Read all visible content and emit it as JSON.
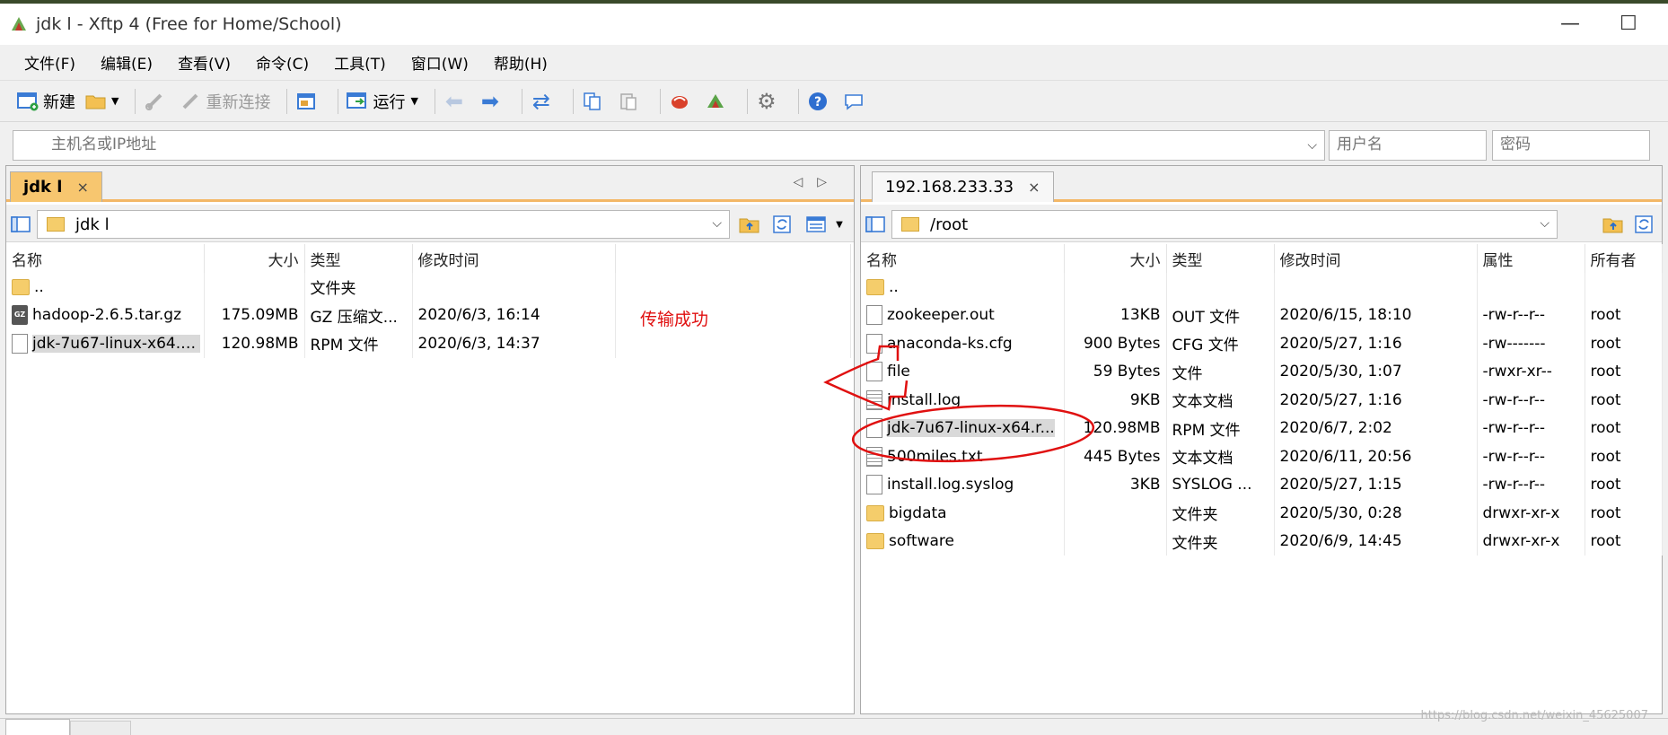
{
  "window": {
    "title": "jdk l - Xftp 4 (Free for Home/School)",
    "minimize": "—",
    "maximize": "☐"
  },
  "menu": [
    "文件(F)",
    "编辑(E)",
    "查看(V)",
    "命令(C)",
    "工具(T)",
    "窗口(W)",
    "帮助(H)"
  ],
  "toolbar": {
    "new_label": "新建",
    "reconnect_label": "重新连接",
    "run_label": "运行"
  },
  "address": {
    "host_placeholder": "主机名或IP地址",
    "user_placeholder": "用户名",
    "password_placeholder": "密码"
  },
  "left_pane": {
    "tab_label": "jdk l",
    "path": "jdk l",
    "columns": [
      "名称",
      "大小",
      "类型",
      "修改时间"
    ],
    "rows": [
      {
        "name": "..",
        "size": "",
        "type": "文件夹",
        "modified": "",
        "icon": "folder"
      },
      {
        "name": "hadoop-2.6.5.tar.gz",
        "size": "175.09MB",
        "type": "GZ 压缩文...",
        "modified": "2020/6/3, 16:14",
        "icon": "gz"
      },
      {
        "name": "jdk-7u67-linux-x64.r...",
        "size": "120.98MB",
        "type": "RPM 文件",
        "modified": "2020/6/3, 14:37",
        "icon": "doc"
      }
    ],
    "annotation": "传输成功"
  },
  "right_pane": {
    "tab_label": "192.168.233.33",
    "path": "/root",
    "columns": [
      "名称",
      "大小",
      "类型",
      "修改时间",
      "属性",
      "所有者"
    ],
    "rows": [
      {
        "name": "..",
        "size": "",
        "type": "",
        "modified": "",
        "attr": "",
        "owner": "",
        "icon": "folder"
      },
      {
        "name": "zookeeper.out",
        "size": "13KB",
        "type": "OUT 文件",
        "modified": "2020/6/15, 18:10",
        "attr": "-rw-r--r--",
        "owner": "root",
        "icon": "doc"
      },
      {
        "name": "anaconda-ks.cfg",
        "size": "900 Bytes",
        "type": "CFG 文件",
        "modified": "2020/5/27, 1:16",
        "attr": "-rw-------",
        "owner": "root",
        "icon": "doc"
      },
      {
        "name": "file",
        "size": "59 Bytes",
        "type": "文件",
        "modified": "2020/5/30, 1:07",
        "attr": "-rwxr-xr--",
        "owner": "root",
        "icon": "doc"
      },
      {
        "name": "install.log",
        "size": "9KB",
        "type": "文本文档",
        "modified": "2020/5/27, 1:16",
        "attr": "-rw-r--r--",
        "owner": "root",
        "icon": "txt"
      },
      {
        "name": "jdk-7u67-linux-x64.r...",
        "size": "120.98MB",
        "type": "RPM 文件",
        "modified": "2020/6/7, 2:02",
        "attr": "-rw-r--r--",
        "owner": "root",
        "icon": "doc"
      },
      {
        "name": "500miles.txt",
        "size": "445 Bytes",
        "type": "文本文档",
        "modified": "2020/6/11, 20:56",
        "attr": "-rw-r--r--",
        "owner": "root",
        "icon": "txt"
      },
      {
        "name": "install.log.syslog",
        "size": "3KB",
        "type": "SYSLOG ...",
        "modified": "2020/5/27, 1:15",
        "attr": "-rw-r--r--",
        "owner": "root",
        "icon": "doc"
      },
      {
        "name": "bigdata",
        "size": "",
        "type": "文件夹",
        "modified": "2020/5/30, 0:28",
        "attr": "drwxr-xr-x",
        "owner": "root",
        "icon": "folder"
      },
      {
        "name": "software",
        "size": "",
        "type": "文件夹",
        "modified": "2020/6/9, 14:45",
        "attr": "drwxr-xr-x",
        "owner": "root",
        "icon": "folder"
      }
    ]
  },
  "colors": {
    "active_tab": "#f7c66f",
    "annotation_red": "#e01010"
  },
  "watermark": "https://blog.csdn.net/weixin_45625007"
}
